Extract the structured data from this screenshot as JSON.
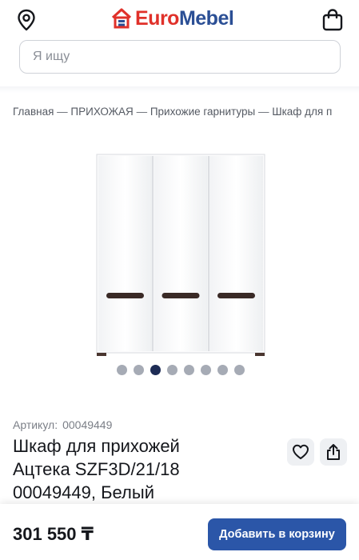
{
  "header": {
    "logo": {
      "part1": "Euro",
      "part2": "Mebel"
    },
    "location_icon": "map-pin-icon",
    "cart_icon": "shopping-bag-icon"
  },
  "search": {
    "placeholder": "Я ищу",
    "value": ""
  },
  "breadcrumb": {
    "items": [
      "Главная",
      "ПРИХОЖАЯ",
      "Прихожие гарнитуры",
      "Шкаф для п"
    ],
    "separator": "—"
  },
  "gallery": {
    "dot_count": 8,
    "active_index": 2
  },
  "product": {
    "sku_label": "Артикул:",
    "sku_value": "00049449",
    "title_lines": [
      "Шкаф для прихожей",
      "Ацтека SZF3D/21/18",
      "00049449, Белый"
    ],
    "favorite_icon": "heart-icon",
    "share_icon": "share-icon"
  },
  "purchase": {
    "price": "301 550 ₸",
    "add_to_cart_label": "Добавить в корзину"
  },
  "colors": {
    "brand_red": "#e0312a",
    "brand_blue": "#2b4f95",
    "button_blue": "#2b56a8",
    "dot_active": "#1e2c55",
    "dot_inactive": "#a6abb5"
  }
}
